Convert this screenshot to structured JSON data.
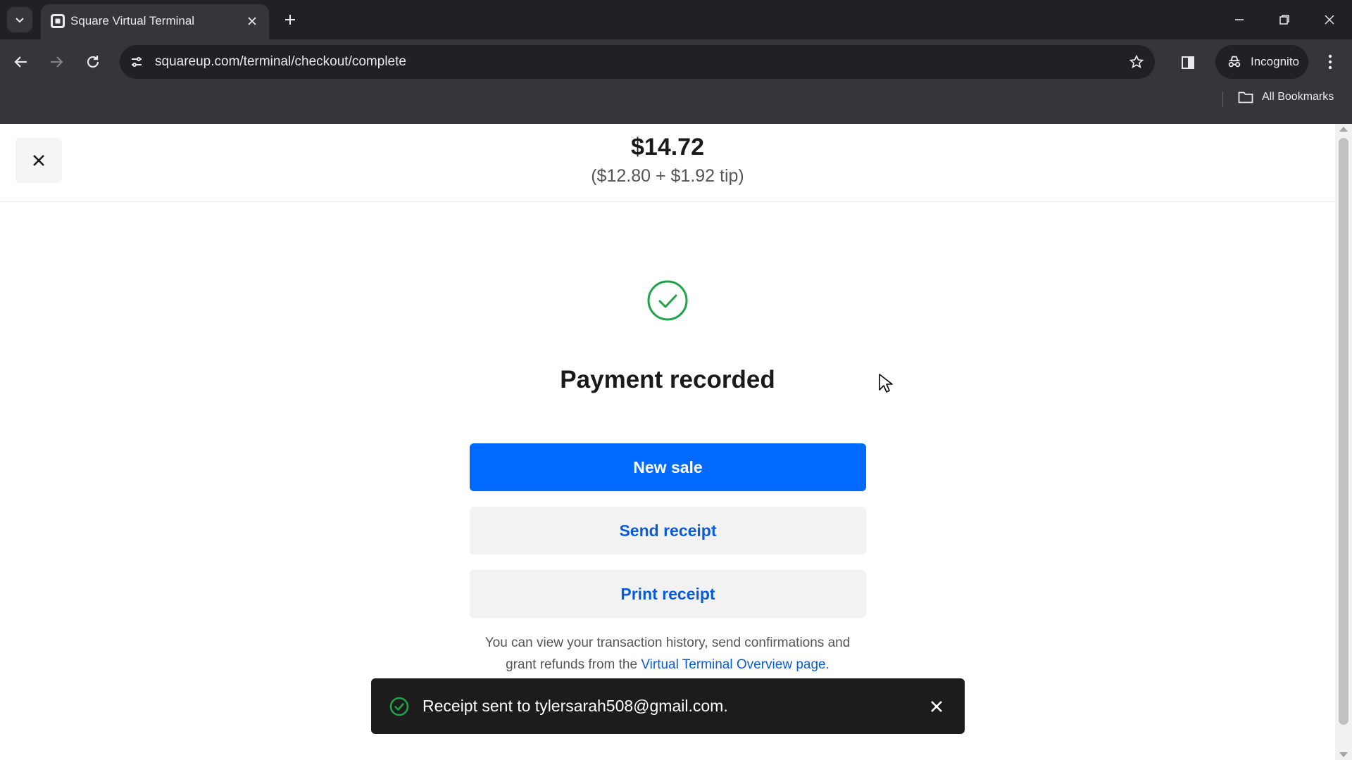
{
  "browser": {
    "tab_title": "Square Virtual Terminal",
    "url": "squareup.com/terminal/checkout/complete",
    "incognito_label": "Incognito",
    "bookmarks_label": "All Bookmarks"
  },
  "header": {
    "total": "$14.72",
    "breakdown": "($12.80 + $1.92 tip)"
  },
  "main": {
    "title": "Payment recorded",
    "new_sale_label": "New sale",
    "send_receipt_label": "Send receipt",
    "print_receipt_label": "Print receipt",
    "info_line1": "You can view your transaction history, send confirmations and",
    "info_line2_prefix": "grant refunds from the ",
    "info_link": "Virtual Terminal Overview page",
    "info_line2_suffix": "."
  },
  "toast": {
    "message": "Receipt sent to tylersarah508@gmail.com."
  },
  "colors": {
    "primary": "#006aff",
    "link": "#0a5cd6",
    "success": "#1fa34a",
    "toast_bg": "#1c1c1c"
  },
  "icons": [
    "tab-search-icon",
    "square-favicon-icon",
    "close-tab-icon",
    "new-tab-icon",
    "minimize-icon",
    "restore-icon",
    "close-window-icon",
    "back-icon",
    "forward-icon",
    "reload-icon",
    "site-settings-icon",
    "bookmark-star-icon",
    "side-panel-icon",
    "incognito-icon",
    "menu-icon",
    "folder-icon",
    "close-icon",
    "success-check-icon"
  ]
}
